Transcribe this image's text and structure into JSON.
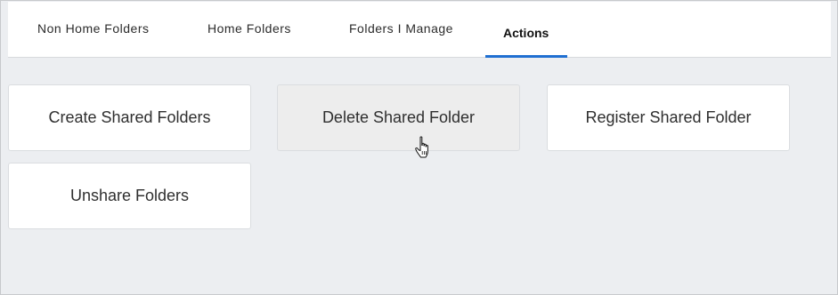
{
  "tabs": [
    {
      "label": "Non Home Folders",
      "active": false
    },
    {
      "label": "Home Folders",
      "active": false
    },
    {
      "label": "Folders I Manage",
      "active": false
    },
    {
      "label": "Actions",
      "active": true
    }
  ],
  "colors": {
    "active_tab_underline": "#1f6fd1",
    "page_background": "#eceef1",
    "card_background": "#ffffff",
    "hovered_card_background": "#ededed"
  },
  "actions": [
    {
      "label": "Create Shared Folders"
    },
    {
      "label": "Delete Shared Folder",
      "state": "hovered"
    },
    {
      "label": "Register Shared Folder"
    },
    {
      "label": "Unshare Folders"
    }
  ],
  "cursor_icon": "hand-pointer-icon"
}
